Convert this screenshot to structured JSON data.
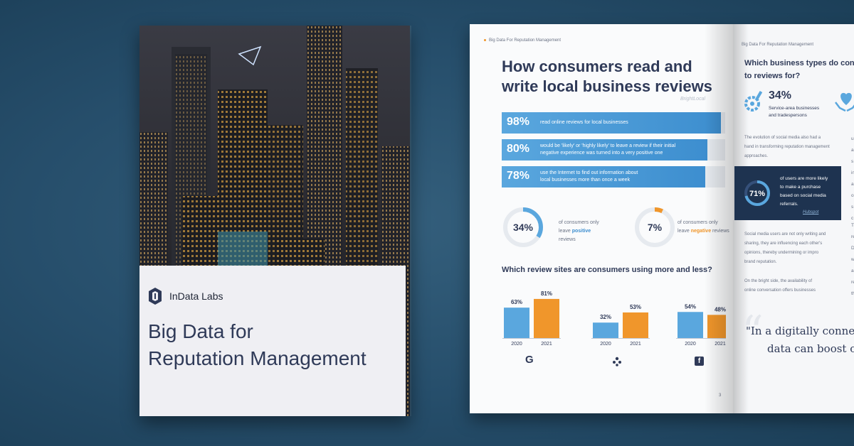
{
  "cover": {
    "brand_name": "InData Labs",
    "title_line1": "Big Data for",
    "title_line2": "Reputation Management"
  },
  "left_page": {
    "running_head": "Big Data For Reputation Management",
    "headline_line1": "How consumers read and",
    "headline_line2": "write local business reviews",
    "source": "BrightLocal",
    "stats": [
      {
        "percent": "98%",
        "line1": "read online reviews for local businesses",
        "line2": ""
      },
      {
        "percent": "80%",
        "line1": "would be 'likely' or 'highly likely' to leave a review if their initial",
        "line2": "negative experience was turned into a very positive one"
      },
      {
        "percent": "78%",
        "line1": "use the Internet to find out information about",
        "line2": "local businesses more than once a week"
      }
    ],
    "donuts": [
      {
        "value": "34%",
        "line1": "of consumers only",
        "line2_prefix": "leave ",
        "highlight": "positive",
        "line2_suffix": " reviews",
        "fraction": 0.34
      },
      {
        "value": "7%",
        "line1": "of consumers only",
        "line2_prefix": "leave ",
        "highlight": "negative",
        "line2_suffix": " reviews",
        "fraction": 0.07
      }
    ],
    "section_question": "Which review sites are consumers using more and less?",
    "page_number": "3",
    "icons": [
      "google-icon",
      "yelp-icon",
      "facebook-icon"
    ]
  },
  "chart_data": {
    "type": "bar",
    "groups": [
      "G",
      "Yelp",
      "Facebook"
    ],
    "categories": [
      "2020",
      "2021"
    ],
    "series": [
      {
        "name": "2020",
        "values": [
          63,
          32,
          54
        ]
      },
      {
        "name": "2021",
        "values": [
          81,
          53,
          48
        ]
      }
    ],
    "data_labels": [
      [
        "63%",
        "81%"
      ],
      [
        "32%",
        "53%"
      ],
      [
        "54%",
        "48%"
      ]
    ],
    "colors": {
      "2020": "#5aa7de",
      "2021": "#f0962b"
    },
    "ylim": [
      0,
      100
    ]
  },
  "right_page": {
    "running_head": "Big Data For Reputation Management",
    "question_line1": "Which business types do consu",
    "question_line2": "to reviews for?",
    "stat_value": "34%",
    "stat_text_line1": "Service-area businesses",
    "stat_text_line2": "and tradespersons",
    "para1": [
      "The evolution of social media also had a",
      "hand in transforming reputation management",
      "approaches."
    ],
    "side_letters": [
      "u",
      "a",
      "s",
      "in",
      "al",
      "o",
      "s",
      "c"
    ],
    "card": {
      "value": "71%",
      "fraction": 0.71,
      "text": [
        "of users are more likely",
        "to make a purchase",
        "based on social media",
        "referrals."
      ],
      "source": "Hubspot"
    },
    "para2": [
      "Social media users are not only writing and",
      "sharing, they are influencing each other's",
      "opinions, thereby undermining or impro",
      "brand reputation."
    ],
    "para3": [
      "On the bright side, the availability of",
      "online conversation offers businesses"
    ],
    "side_letters2": [
      "T",
      "re",
      "D",
      "w",
      "ar",
      "re",
      "th"
    ],
    "quote_line1": "\"In a digitally connect",
    "quote_line2": "data can boost o"
  },
  "colors": {
    "background": "#264e6b",
    "accent_blue": "#3d8ecf",
    "accent_orange": "#f0962b",
    "text_dark": "#2f3a58"
  }
}
